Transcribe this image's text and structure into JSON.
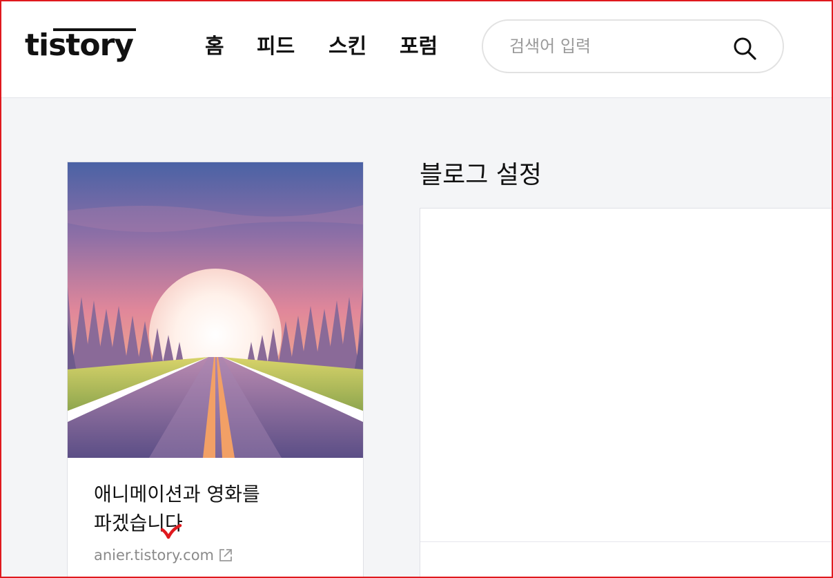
{
  "header": {
    "logo": "tistory",
    "nav": [
      {
        "label": "홈"
      },
      {
        "label": "피드"
      },
      {
        "label": "스킨"
      },
      {
        "label": "포럼"
      }
    ],
    "search": {
      "placeholder": "검색어 입력",
      "value": "",
      "icon": "search-icon"
    }
  },
  "blog_card": {
    "title": "애니메이션과 영화를 파겠습니다",
    "url": "anier.tistory.com",
    "url_icon": "external-link-icon",
    "annotation_icon": "checkmark-icon",
    "annotation_color": "#e0191e"
  },
  "main": {
    "title": "블로그 설정"
  },
  "colors": {
    "frame": "#e0191e",
    "background": "#f4f5f7",
    "text": "#111111",
    "muted": "#8a8a8a"
  }
}
